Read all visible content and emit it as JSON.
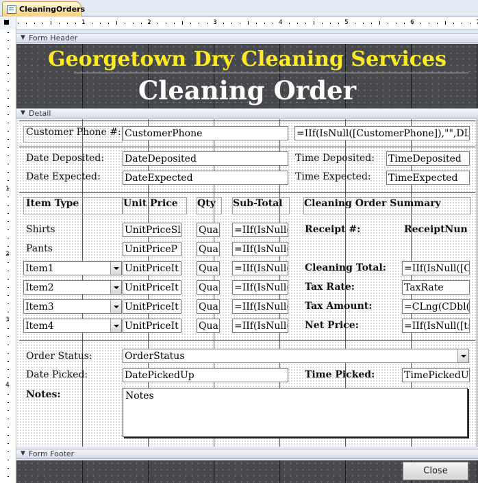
{
  "tab": {
    "label": "CleaningOrders"
  },
  "ruler": {
    "h_numbers": [
      "1",
      "2",
      "3",
      "4",
      "5",
      "6",
      "7"
    ],
    "v_numbers": [
      "1",
      "2",
      "3",
      "4"
    ]
  },
  "sections": {
    "header": "Form Header",
    "detail": "Detail",
    "footer": "Form Footer"
  },
  "header": {
    "company": "Georgetown Dry Cleaning Services",
    "title": "Cleaning Order"
  },
  "customer": {
    "label": "Customer Phone #:",
    "field": "CustomerPhone",
    "expr": "=IIf(IsNull([CustomerPhone]),\"\",DL"
  },
  "dates": {
    "deposited_label": "Date Deposited:",
    "deposited_field": "DateDeposited",
    "time_deposited_label": "Time Deposited:",
    "time_deposited_field": "TimeDeposited",
    "expected_label": "Date Expected:",
    "expected_field": "DateExpected",
    "time_expected_label": "Time Expected:",
    "time_expected_field": "TimeExpected"
  },
  "items": {
    "headers": {
      "type": "Item Type",
      "price": "Unit Price",
      "qty": "Qty",
      "subtotal": "Sub-Total"
    },
    "rows": [
      {
        "type": "Shirts",
        "price": "UnitPriceSl",
        "qty": "Qua",
        "subtotal": "=IIf(IsNull("
      },
      {
        "type": "Pants",
        "price": "UnitPriceP",
        "qty": "Qua",
        "subtotal": "=IIf(IsNull("
      },
      {
        "type": "Item1",
        "price": "UnitPriceIt",
        "qty": "Qua",
        "subtotal": "=IIf(IsNull("
      },
      {
        "type": "Item2",
        "price": "UnitPriceIt",
        "qty": "Qua",
        "subtotal": "=IIf(IsNull("
      },
      {
        "type": "Item3",
        "price": "UnitPriceIt",
        "qty": "Qua",
        "subtotal": "=IIf(IsNull("
      },
      {
        "type": "Item4",
        "price": "UnitPriceIt",
        "qty": "Qua",
        "subtotal": "=IIf(IsNull("
      }
    ]
  },
  "summary": {
    "title": "Cleaning Order Summary",
    "receipt_label": "Receipt #:",
    "receipt_value": "ReceiptNun",
    "cleaning_total_label": "Cleaning Total:",
    "cleaning_total_value": "=IIf(IsNull([C",
    "tax_rate_label": "Tax Rate:",
    "tax_rate_value": "TaxRate",
    "tax_amount_label": "Tax Amount:",
    "tax_amount_value": "=CLng(CDbl(",
    "net_price_label": "Net Price:",
    "net_price_value": "=IIf(IsNull([t:"
  },
  "status": {
    "order_status_label": "Order Status:",
    "order_status_field": "OrderStatus",
    "date_picked_label": "Date Picked:",
    "date_picked_field": "DatePickedUp",
    "time_picked_label": "Time Picked:",
    "time_picked_field": "TimePickedU"
  },
  "notes": {
    "label": "Notes:",
    "field": "Notes"
  },
  "footer": {
    "close_label": "Close"
  }
}
